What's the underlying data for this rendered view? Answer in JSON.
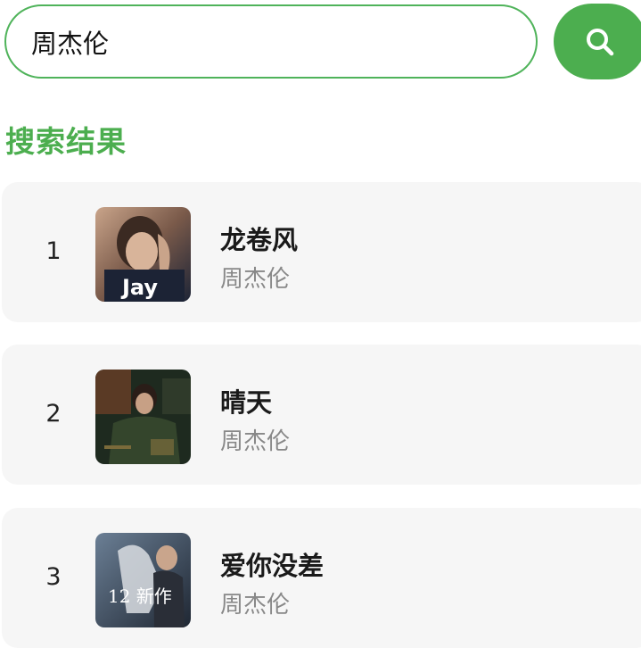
{
  "search": {
    "value": "周杰伦",
    "button_icon": "search-icon"
  },
  "section_title": "搜索结果",
  "colors": {
    "accent": "#4cae4f",
    "card_bg": "#f6f6f6",
    "artist_text": "#888888"
  },
  "results": [
    {
      "rank": "1",
      "title": "龙卷风",
      "artist": "周杰伦",
      "cover_text": "Jay"
    },
    {
      "rank": "2",
      "title": "晴天",
      "artist": "周杰伦"
    },
    {
      "rank": "3",
      "title": "爱你没差",
      "artist": "周杰伦",
      "cover_text": "12 新作"
    }
  ]
}
